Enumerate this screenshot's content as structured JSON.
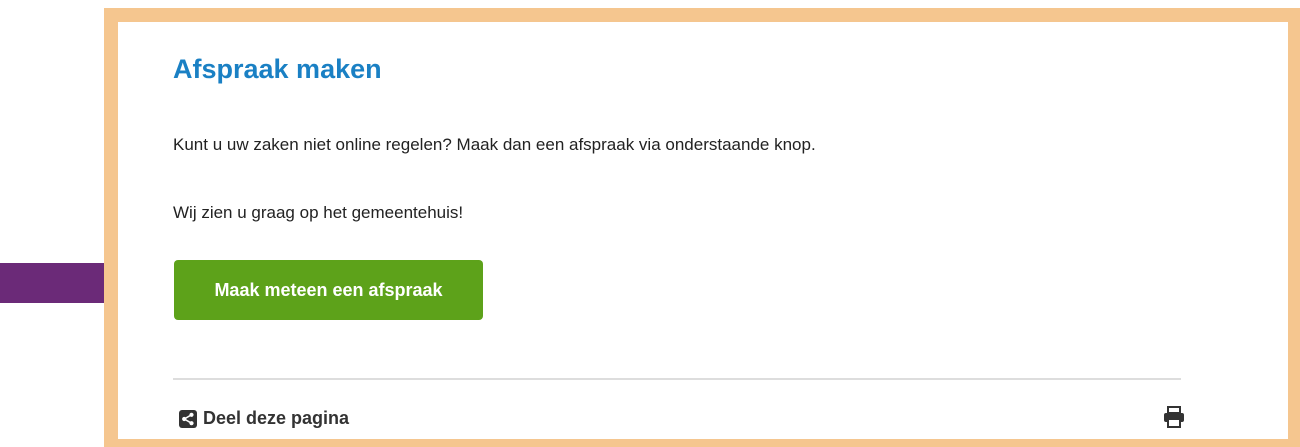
{
  "section": {
    "title": "Afspraak maken",
    "paragraph_1": "Kunt u uw zaken niet online regelen? Maak dan een afspraak via onderstaande knop.",
    "paragraph_2": "Wij zien u graag op het gemeentehuis!",
    "cta_label": "Maak meteen een afspraak"
  },
  "footer": {
    "share_label": "Deel deze pagina",
    "share_icon": "share-icon",
    "print_icon": "printer-icon"
  },
  "annotation": {
    "pointer": "arrow-right-icon"
  },
  "colors": {
    "frame_border": "#f5c68f",
    "title": "#1a80c4",
    "cta_background": "#5da21a",
    "arrow": "#6b2a78"
  }
}
